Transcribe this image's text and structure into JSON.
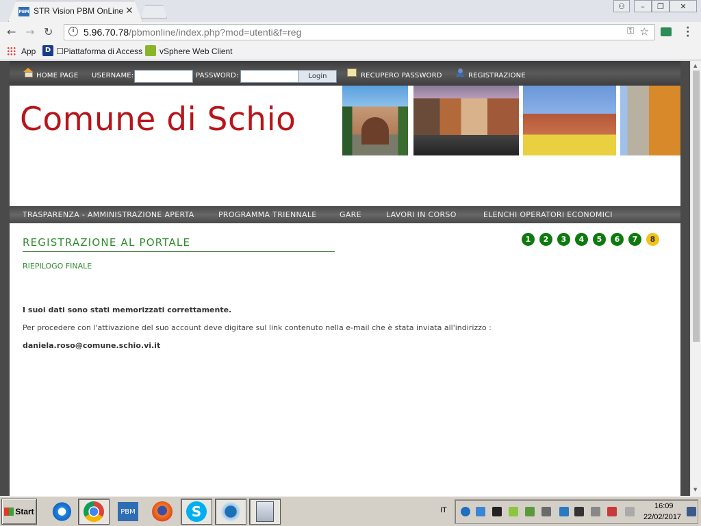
{
  "browser": {
    "tab_title": "STR Vision PBM OnLine",
    "tab_favicon": "PBM",
    "tab_close": "✕",
    "url_host": "5.96.70.78",
    "url_path": "/pbmonline/index.php?mod=utenti&f=reg",
    "bookmarks": [
      {
        "label": "App",
        "icon": "apps-icon"
      },
      {
        "label": "☐Piattaforma di Access",
        "icon": "d-icon"
      },
      {
        "label": "vSphere Web Client",
        "icon": "vsphere-icon"
      }
    ]
  },
  "site": {
    "topbar": {
      "home": "HOME PAGE",
      "username_label": "USERNAME:",
      "password_label": "PASSWORD:",
      "login_button": "Login",
      "recover": "RECUPERO PASSWORD",
      "register": "REGISTRAZIONE"
    },
    "logo_text": "Comune di Schio",
    "nav": [
      "TRASPARENZA - AMMINISTRAZIONE APERTA",
      "PROGRAMMA TRIENNALE",
      "GARE",
      "LAVORI IN CORSO",
      "ELENCHI OPERATORI ECONOMICI"
    ],
    "page_title": "REGISTRAZIONE AL PORTALE",
    "subtitle": "RIEPILOGO FINALE",
    "steps": [
      "1",
      "2",
      "3",
      "4",
      "5",
      "6",
      "7",
      "8"
    ],
    "active_step": "8",
    "message_bold": "I suoi dati sono stati memorizzati correttamente.",
    "message_body": "Per procedere con l'attivazione del suo account deve digitare sul link contenuto nella e-mail che è stata inviata all'indirizzo :",
    "email": "daniela.roso@comune.schio.vi.it"
  },
  "taskbar": {
    "start": "Start",
    "language": "IT",
    "time": "16:09",
    "date": "22/02/2017",
    "pbm_label": "PBM"
  },
  "colors": {
    "accent_green": "#2e8b2e",
    "step_green": "#0e7a0e",
    "step_active": "#f2c21b",
    "logo_red": "#b8151b"
  }
}
